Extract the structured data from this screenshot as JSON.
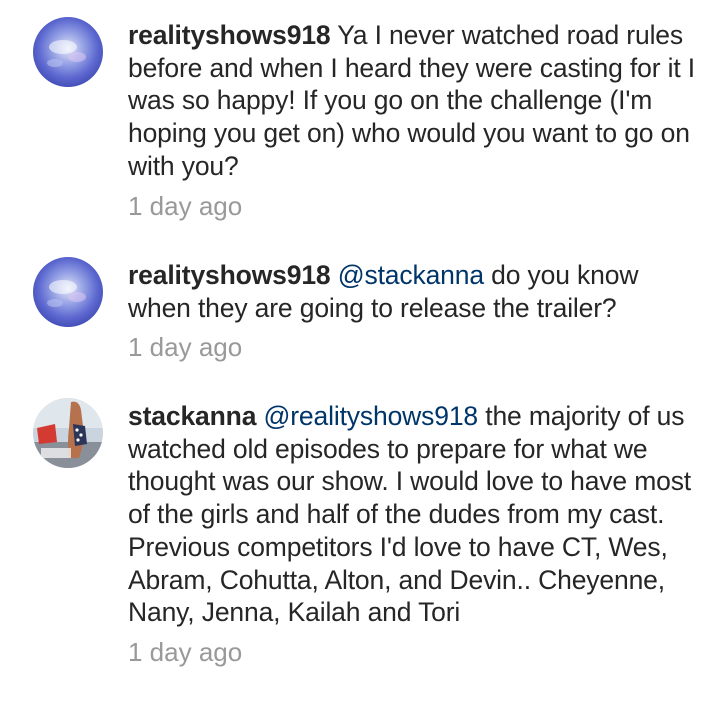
{
  "comments": [
    {
      "username": "realityshows918",
      "mention": "",
      "text": "Ya I never watched road rules before and when I heard they were casting for it I was so happy! If you go on the challenge (I'm hoping you get on) who would you want to go on with you?",
      "time": "1 day ago"
    },
    {
      "username": "realityshows918",
      "mention": "@stackanna",
      "text": "do you know when they are going to release the trailer?",
      "time": "1 day ago"
    },
    {
      "username": "stackanna",
      "mention": "@realityshows918",
      "text": "the majority of us watched old episodes to prepare for what we thought was our show. I would love to have most of the girls and half of the dudes from my cast. Previous competitors I'd love to have CT, Wes, Abram, Cohutta, Alton, and Devin.. Cheyenne, Nany, Jenna, Kailah and Tori",
      "time": "1 day ago"
    }
  ]
}
